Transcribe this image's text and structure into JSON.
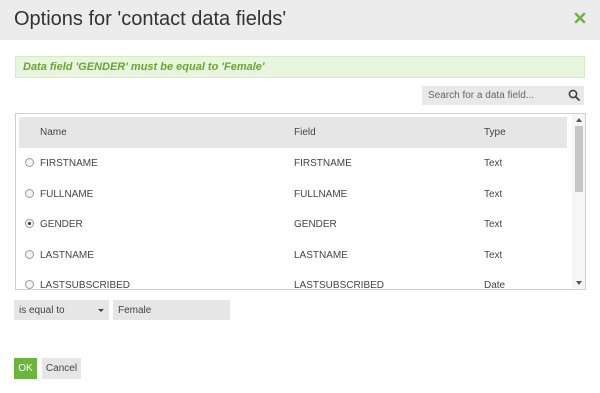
{
  "dialog": {
    "title": "Options for 'contact data fields'",
    "close_icon": "close-x-icon",
    "accent_color": "#6cb33f"
  },
  "alert": {
    "message": "Data field 'GENDER' must be equal to 'Female'"
  },
  "search": {
    "placeholder": "Search for a data field...",
    "icon": "search-icon"
  },
  "table": {
    "columns": [
      "Name",
      "Field",
      "Type"
    ],
    "rows": [
      {
        "name": "FIRSTNAME",
        "field": "FIRSTNAME",
        "type": "Text",
        "selected": false
      },
      {
        "name": "FULLNAME",
        "field": "FULLNAME",
        "type": "Text",
        "selected": false
      },
      {
        "name": "GENDER",
        "field": "GENDER",
        "type": "Text",
        "selected": true
      },
      {
        "name": "LASTNAME",
        "field": "LASTNAME",
        "type": "Text",
        "selected": false
      },
      {
        "name": "LASTSUBSCRIBED",
        "field": "LASTSUBSCRIBED",
        "type": "Date",
        "selected": false
      }
    ]
  },
  "condition": {
    "operator": "is equal to",
    "value": "Female"
  },
  "buttons": {
    "ok": "OK",
    "cancel": "Cancel"
  }
}
